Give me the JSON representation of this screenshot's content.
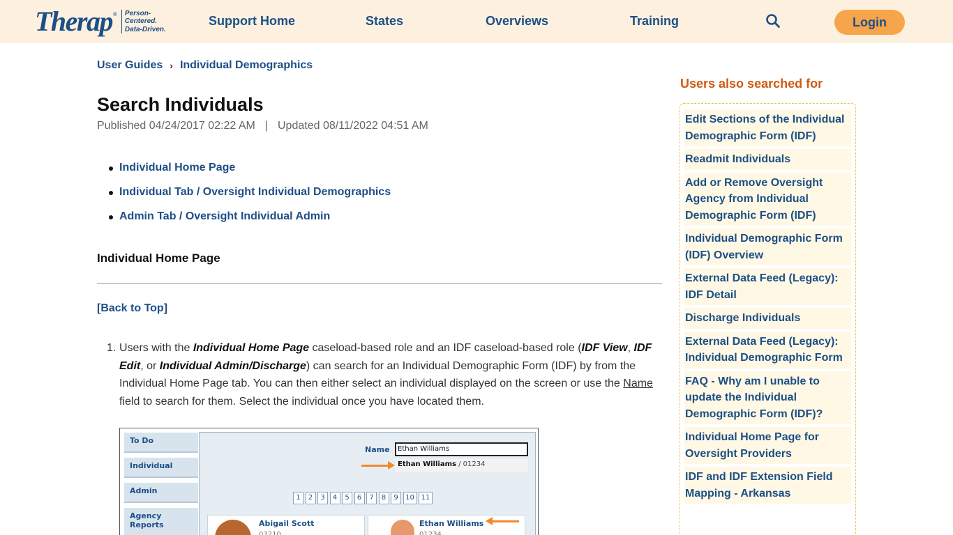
{
  "header": {
    "logo_text": "Therap",
    "logo_reg": "®",
    "tagline_1": "Person-Centered.",
    "tagline_2": "Data-Driven.",
    "nav": [
      "Support Home",
      "States",
      "Overviews",
      "Training"
    ],
    "login_label": "Login"
  },
  "breadcrumb": {
    "items": [
      "User Guides",
      "Individual Demographics"
    ],
    "separator": "›"
  },
  "article": {
    "title": "Search Individuals",
    "published": "Published 04/24/2017 02:22 AM",
    "meta_sep": "|",
    "updated": "Updated 08/11/2022 04:51 AM",
    "toc": [
      "Individual Home Page",
      "Individual Tab / Oversight Individual Demographics",
      "Admin Tab / Oversight Individual Admin"
    ],
    "section_heading": "Individual Home Page",
    "back_to_top": "[Back to Top]",
    "step_number": "1.",
    "step_parts": {
      "p1": "Users with the ",
      "b1": "Individual Home Page",
      "p2": " caseload-based role and an IDF caseload-based role (",
      "b2": "IDF View",
      "p3": ", ",
      "b3": "IDF Edit",
      "p4": ", or ",
      "b4": "Individual Admin/Discharge",
      "p5": ") can search for an Individual Demographic Form (IDF) by from the Individual Home Page tab. You can then either select an individual displayed on the screen or use the ",
      "u1": "Name",
      "p6": " field to search for them. Select the individual once you have located them."
    }
  },
  "screenshot": {
    "tabs": [
      "To Do",
      "Individual",
      "Admin",
      "Agency Reports"
    ],
    "name_label": "Name",
    "name_value": "Ethan Williams",
    "suggestion_name": "Ethan Williams",
    "suggestion_id": " / 01234",
    "pages": [
      "1",
      "2",
      "3",
      "4",
      "5",
      "6",
      "7",
      "8",
      "9",
      "10",
      "11"
    ],
    "cards": [
      {
        "name": "Abigail Scott",
        "id": "03210"
      },
      {
        "name": "Ethan Williams",
        "id": "01234"
      }
    ]
  },
  "sidebar": {
    "title": "Users also searched for",
    "items": [
      "Edit Sections of the Individual Demographic Form (IDF)",
      "Readmit Individuals",
      "Add or Remove Oversight Agency from Individual Demographic Form (IDF)",
      "Individual Demographic Form (IDF) Overview",
      "External Data Feed (Legacy): IDF Detail",
      "Discharge Individuals",
      "External Data Feed (Legacy): Individual Demographic Form",
      "FAQ - Why am I unable to update the Individual Demographic Form (IDF)?",
      "Individual Home Page for Oversight Providers",
      "IDF and IDF Extension Field Mapping - Arkansas"
    ]
  },
  "colors": {
    "brand_blue": "#1d4f86",
    "header_bg": "#fdf0df",
    "login_orange": "#f7a54a",
    "sidebar_title": "#cf5a12",
    "sidebar_item_bg": "#fff8e5"
  },
  "icons": {
    "search": "search-icon",
    "chevron": "chevron-right-icon"
  }
}
